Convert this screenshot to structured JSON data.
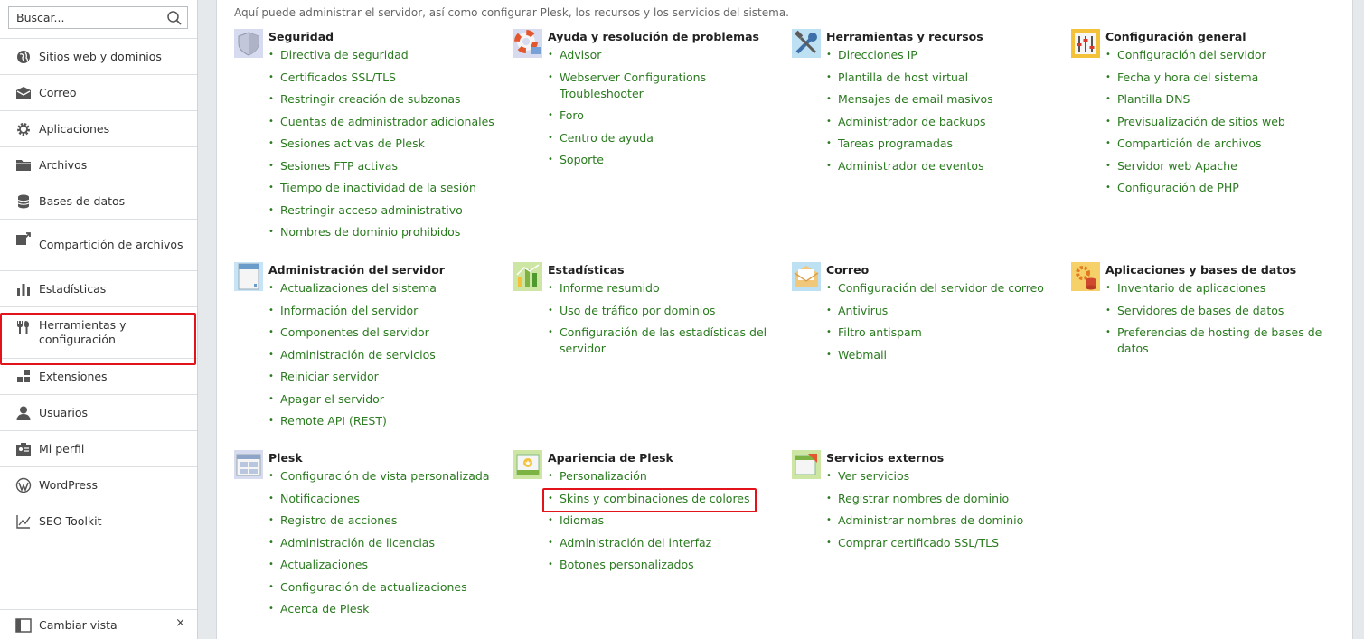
{
  "search": {
    "placeholder": "Buscar..."
  },
  "nav": [
    {
      "label": "Sitios web y dominios",
      "icon": "globe-icon"
    },
    {
      "label": "Correo",
      "icon": "mail-icon"
    },
    {
      "label": "Aplicaciones",
      "icon": "gear-icon"
    },
    {
      "label": "Archivos",
      "icon": "folder-icon"
    },
    {
      "label": "Bases de datos",
      "icon": "database-icon"
    },
    {
      "label": "Compartición de archivos",
      "icon": "share-icon"
    },
    {
      "label": "Estadísticas",
      "icon": "bar-chart-icon"
    },
    {
      "label": "Herramientas y configuración",
      "icon": "tools-icon"
    },
    {
      "label": "Extensiones",
      "icon": "puzzle-icon"
    },
    {
      "label": "Usuarios",
      "icon": "user-icon"
    },
    {
      "label": "Mi perfil",
      "icon": "profile-icon"
    },
    {
      "label": "WordPress",
      "icon": "wordpress-icon"
    },
    {
      "label": "SEO Toolkit",
      "icon": "seo-icon"
    }
  ],
  "bottom": {
    "label": "Cambiar vista",
    "close": "×"
  },
  "intro": "Aquí puede administrar el servidor, así como configurar Plesk, los recursos y los servicios del sistema.",
  "sections": [
    {
      "title": "Seguridad",
      "icon": "shield-icon",
      "items": [
        "Directiva de seguridad",
        "Certificados SSL/TLS",
        "Restringir creación de subzonas",
        "Cuentas de administrador adicionales",
        "Sesiones activas de Plesk",
        "Sesiones FTP activas",
        "Tiempo de inactividad de la sesión",
        "Restringir acceso administrativo",
        "Nombres de dominio prohibidos"
      ]
    },
    {
      "title": "Ayuda y resolución de problemas",
      "icon": "lifebuoy-icon",
      "items": [
        "Advisor",
        "Webserver Configurations Troubleshooter",
        "Foro",
        "Centro de ayuda",
        "Soporte"
      ]
    },
    {
      "title": "Herramientas y recursos",
      "icon": "wrench-icon",
      "items": [
        "Direcciones IP",
        "Plantilla de host virtual",
        "Mensajes de email masivos",
        "Administrador de backups",
        "Tareas programadas",
        "Administrador de eventos"
      ]
    },
    {
      "title": "Configuración general",
      "icon": "sliders-icon",
      "items": [
        "Configuración del servidor",
        "Fecha y hora del sistema",
        "Plantilla DNS",
        "Previsualización de sitios web",
        "Compartición de archivos",
        "Servidor web Apache",
        "Configuración de PHP"
      ]
    },
    {
      "title": "Administración del servidor",
      "icon": "server-icon",
      "items": [
        "Actualizaciones del sistema",
        "Información del servidor",
        "Componentes del servidor",
        "Administración de servicios",
        "Reiniciar servidor",
        "Apagar el servidor",
        "Remote API (REST)"
      ]
    },
    {
      "title": "Estadísticas",
      "icon": "stats-icon",
      "items": [
        "Informe resumido",
        "Uso de tráfico por dominios",
        "Configuración de las estadísticas del servidor"
      ]
    },
    {
      "title": "Correo",
      "icon": "envelope-icon",
      "items": [
        "Configuración del servidor de correo",
        "Antivirus",
        "Filtro antispam",
        "Webmail"
      ]
    },
    {
      "title": "Aplicaciones y bases de datos",
      "icon": "apps-db-icon",
      "items": [
        "Inventario de aplicaciones",
        "Servidores de bases de datos",
        "Preferencias de hosting de bases de datos"
      ]
    },
    {
      "title": "Plesk",
      "icon": "plesk-window-icon",
      "items": [
        "Configuración de vista personalizada",
        "Notificaciones",
        "Registro de acciones",
        "Administración de licencias",
        "Actualizaciones",
        "Configuración de actualizaciones",
        "Acerca de Plesk"
      ]
    },
    {
      "title": "Apariencia de Plesk",
      "icon": "appearance-icon",
      "items": [
        "Personalización",
        "Skins y combinaciones de colores",
        "Idiomas",
        "Administración del interfaz",
        "Botones personalizados"
      ]
    },
    {
      "title": "Servicios externos",
      "icon": "external-services-icon",
      "items": [
        "Ver servicios",
        "Registrar nombres de dominio",
        "Administrar nombres de dominio",
        "Comprar certificado SSL/TLS"
      ]
    }
  ],
  "colors": {
    "link": "#2a7a1f",
    "highlight": "#e3131b"
  }
}
